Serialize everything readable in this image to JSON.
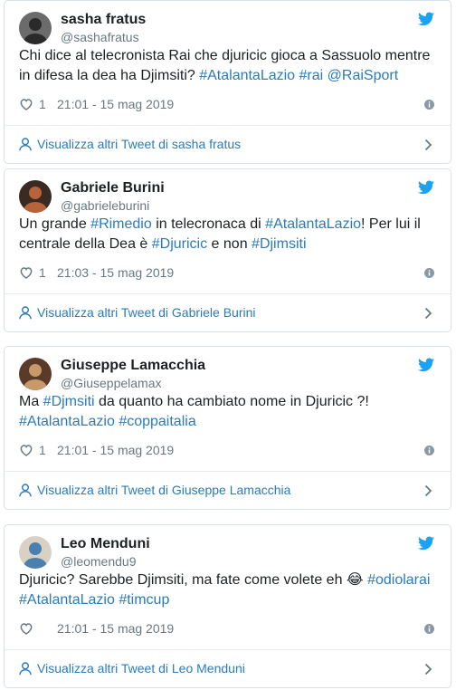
{
  "colors": {
    "accent": "#2b7bb9",
    "twitter_blue": "#1da1f2",
    "muted": "#697882",
    "border": "#d9e1e6"
  },
  "tweets": [
    {
      "display_name": "sasha fratus",
      "handle": "@sashafratus",
      "segments": [
        {
          "t": "Chi dice al telecronista Rai che djuricic gioca a Sassuolo mentre in difesa la dea ha Djimsiti? ",
          "tag": false
        },
        {
          "t": "#AtalantaLazio",
          "tag": true
        },
        {
          "t": " ",
          "tag": false
        },
        {
          "t": "#rai",
          "tag": true
        },
        {
          "t": " ",
          "tag": false
        },
        {
          "t": "@RaiSport",
          "tag": true
        }
      ],
      "likes": "1",
      "time": "21:01 - 15 mag 2019",
      "more": "Visualizza altri Tweet di sasha fratus"
    },
    {
      "display_name": "Gabriele Burini",
      "handle": "@gabrieleburini",
      "segments": [
        {
          "t": "Un grande ",
          "tag": false
        },
        {
          "t": "#Rimedio",
          "tag": true
        },
        {
          "t": " in telecronaca di ",
          "tag": false
        },
        {
          "t": "#AtalantaLazio",
          "tag": true
        },
        {
          "t": "! Per lui il centrale della Dea è ",
          "tag": false
        },
        {
          "t": "#Djuricic",
          "tag": true
        },
        {
          "t": " e non ",
          "tag": false
        },
        {
          "t": "#Djimsiti",
          "tag": true
        }
      ],
      "likes": "1",
      "time": "21:03 - 15 mag 2019",
      "more": "Visualizza altri Tweet di Gabriele Burini"
    },
    {
      "display_name": "Giuseppe Lamacchia",
      "handle": "@Giuseppelamax",
      "segments": [
        {
          "t": "Ma ",
          "tag": false
        },
        {
          "t": "#Djmsiti",
          "tag": true
        },
        {
          "t": " da quanto ha cambiato nome in Djuricic ?! ",
          "tag": false
        },
        {
          "t": "#AtalantaLazio",
          "tag": true
        },
        {
          "t": " ",
          "tag": false
        },
        {
          "t": "#coppaitalia",
          "tag": true
        }
      ],
      "likes": "1",
      "time": "21:01 - 15 mag 2019",
      "more": "Visualizza altri Tweet di Giuseppe Lamacchia"
    },
    {
      "display_name": "Leo Menduni",
      "handle": "@leomendu9",
      "segments": [
        {
          "t": "Djuricic? Sarebbe Djimsiti, ma fate come volete eh ",
          "tag": false
        },
        {
          "t": "😂",
          "tag": false
        },
        {
          "t": " ",
          "tag": false
        },
        {
          "t": "#odiolarai",
          "tag": true
        },
        {
          "t": " ",
          "tag": false
        },
        {
          "t": "#AtalantaLazio",
          "tag": true
        },
        {
          "t": " ",
          "tag": false
        },
        {
          "t": "#timcup",
          "tag": true
        }
      ],
      "likes": "",
      "time": "21:01 - 15 mag 2019",
      "more": "Visualizza altri Tweet di Leo Menduni"
    }
  ]
}
